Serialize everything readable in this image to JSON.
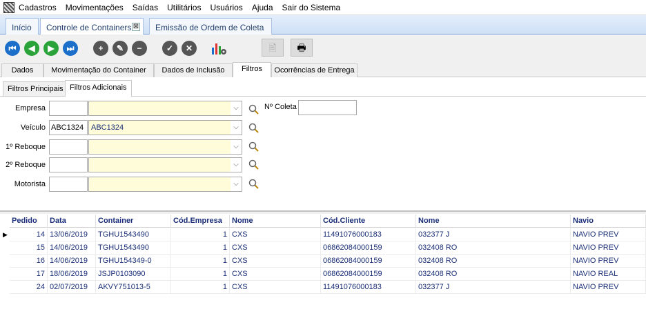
{
  "menu": [
    "Cadastros",
    "Movimentações",
    "Saídas",
    "Utilitários",
    "Usuários",
    "Ajuda",
    "Sair do Sistema"
  ],
  "doc_tabs": [
    {
      "label": "Início"
    },
    {
      "label": "Controle de Containers",
      "close": "⊠"
    },
    {
      "label": "Emissão de Ordem de Coleta"
    }
  ],
  "toolbar": {
    "nav_icons": [
      "first-record-icon",
      "prev-record-icon",
      "next-record-icon",
      "last-record-icon"
    ],
    "edit_icons": [
      "add-icon",
      "edit-icon",
      "delete-icon"
    ],
    "confirm_icons": [
      "confirm-icon",
      "cancel-icon"
    ],
    "chart_icon": "chart-settings-icon",
    "print_icons": [
      "print-preview-icon",
      "printer-icon"
    ]
  },
  "main_tabs": [
    "Dados",
    "Movimentação do Container",
    "Dados de Inclusão",
    "Filtros",
    "Ocorrências de Entrega"
  ],
  "active_main_tab": "Filtros",
  "sub_tabs": [
    "Filtros Principais",
    "Filtros Adicionais"
  ],
  "filters": {
    "empresa": {
      "label": "Empresa",
      "code": "",
      "value": ""
    },
    "veiculo": {
      "label": "Veículo",
      "code": "ABC1324",
      "value": "ABC1324"
    },
    "reboque1": {
      "label": "1º Reboque",
      "code": "",
      "value": ""
    },
    "reboque2": {
      "label": "2º Reboque",
      "code": "",
      "value": ""
    },
    "motorista": {
      "label": "Motorista",
      "code": "",
      "value": ""
    },
    "coleta": {
      "label": "Nº Coleta",
      "value": ""
    }
  },
  "grid": {
    "headers": [
      "Pedido",
      "Data",
      "Container",
      "Cód.Empresa",
      "Nome",
      "Cód.Cliente",
      "Nome",
      "Navio"
    ],
    "rows": [
      [
        "14",
        "13/06/2019",
        "TGHU1543490",
        "1",
        "CXS",
        "11491076000183",
        "032377  J",
        "NAVIO PREV"
      ],
      [
        "15",
        "14/06/2019",
        "TGHU1543490",
        "1",
        "CXS",
        "06862084000159",
        "032408  RO",
        "NAVIO PREV"
      ],
      [
        "16",
        "14/06/2019",
        "TGHU154349-0",
        "1",
        "CXS",
        "06862084000159",
        "032408  RO",
        "NAVIO PREV"
      ],
      [
        "17",
        "18/06/2019",
        "JSJP0103090",
        "1",
        "CXS",
        "06862084000159",
        "032408  RO",
        "NAVIO REAL"
      ],
      [
        "24",
        "02/07/2019",
        "AKVY751013-5",
        "1",
        "CXS",
        "11491076000183",
        "032377  J",
        "NAVIO PREV"
      ]
    ]
  },
  "colors": {
    "accent_blue": "#1b6fc9",
    "accent_green": "#2aa43a",
    "combo_bg": "#fefcd9",
    "grid_text": "#1a2f78"
  }
}
